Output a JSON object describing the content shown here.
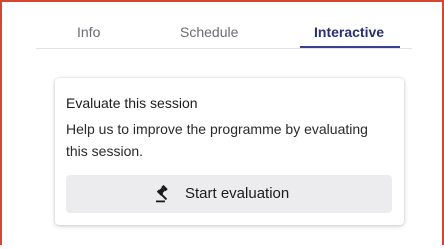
{
  "tabs": {
    "info": "Info",
    "schedule": "Schedule",
    "interactive": "Interactive"
  },
  "card": {
    "title": "Evaluate this session",
    "description": "Help us to improve the programme by evaluating this session.",
    "button_label": "Start evaluation",
    "button_icon": "gavel-icon"
  },
  "colors": {
    "frame_border": "#d6462f",
    "active_tab": "#2b2f6b",
    "button_bg": "#ececee"
  }
}
